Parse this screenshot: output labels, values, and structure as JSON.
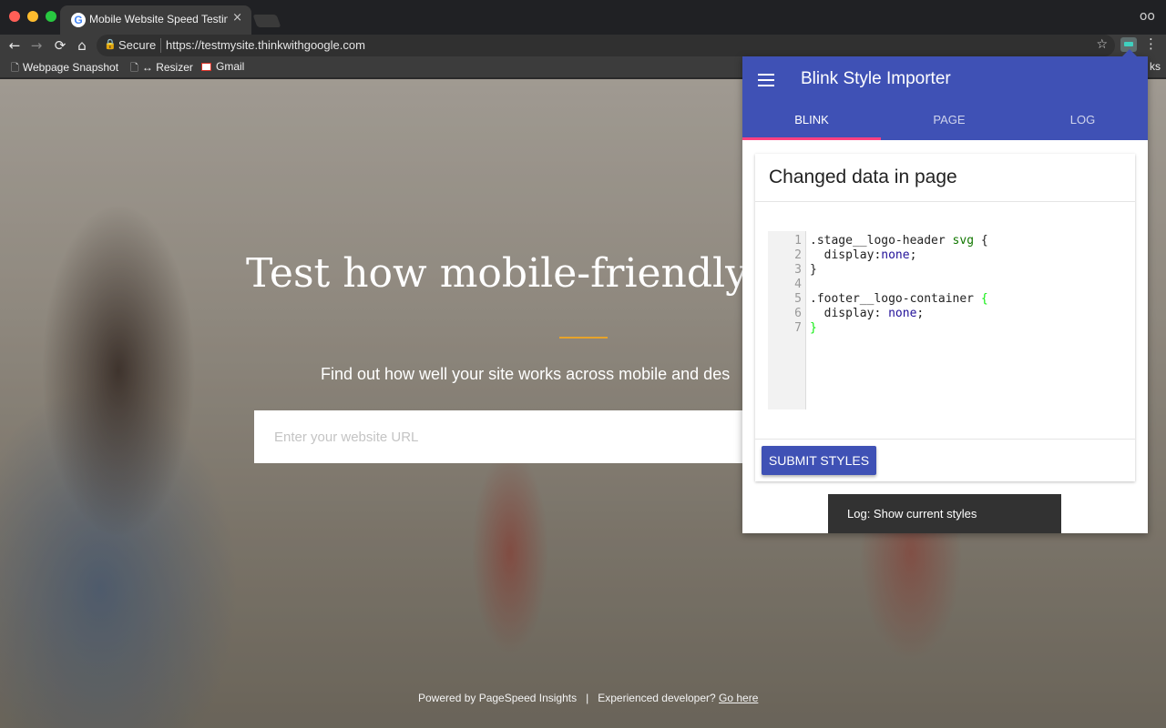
{
  "browser": {
    "tab_title": "Mobile Website Speed Testing",
    "tab_favicon": "G",
    "tab_close": "×",
    "nav": {
      "back_icon": "←",
      "forward_icon": "→",
      "reload_icon": "⟳",
      "home_icon": "⌂"
    },
    "omnibox": {
      "lock_icon": "🔒",
      "secure_label": "Secure",
      "url": "https://testmysite.thinkwithgoogle.com",
      "star_icon": "☆"
    },
    "menu_icon": "⋮",
    "incognito_icon": "oo",
    "bookmarks": [
      {
        "icon": "page-icon",
        "label": "Webpage Snapshot"
      },
      {
        "icon": "page-icon",
        "label": "↔ Resizer"
      },
      {
        "icon": "gmail-icon",
        "label": "Gmail"
      }
    ],
    "bookmarks_overflow": "ks"
  },
  "page": {
    "hero_title": "Test how mobile-friendly yo",
    "hero_subtitle": "Find out how well your site works across mobile and des",
    "url_placeholder": "Enter your website URL",
    "footer": {
      "powered_by": "Powered by PageSpeed Insights",
      "separator": "|",
      "developer_text": "Experienced developer?",
      "developer_link": "Go here"
    },
    "accent_color": "#e8a32a"
  },
  "popup": {
    "title": "Blink Style Importer",
    "tabs": [
      {
        "label": "BLINK",
        "active": true
      },
      {
        "label": "PAGE",
        "active": false
      },
      {
        "label": "LOG",
        "active": false
      }
    ],
    "card_title": "Changed data in page",
    "line_numbers": [
      "1",
      "2",
      "3",
      "4",
      "5",
      "6",
      "7"
    ],
    "code": {
      "l1_selector": ".stage__logo-header ",
      "l1_tag": "svg",
      "l1_brace": " {",
      "l2_prop": "  display:",
      "l2_value": "none",
      "l2_semi": ";",
      "l3": "}",
      "l5_selector": ".footer__logo-container ",
      "l5_brace": "{",
      "l6_prop": "  display: ",
      "l6_value": "none",
      "l6_semi": ";",
      "l7": "}"
    },
    "submit_label": "SUBMIT STYLES",
    "snackbar_text": "Log: Show current styles",
    "primary_color": "#3f51b5",
    "indicator_color": "#ff4081"
  }
}
